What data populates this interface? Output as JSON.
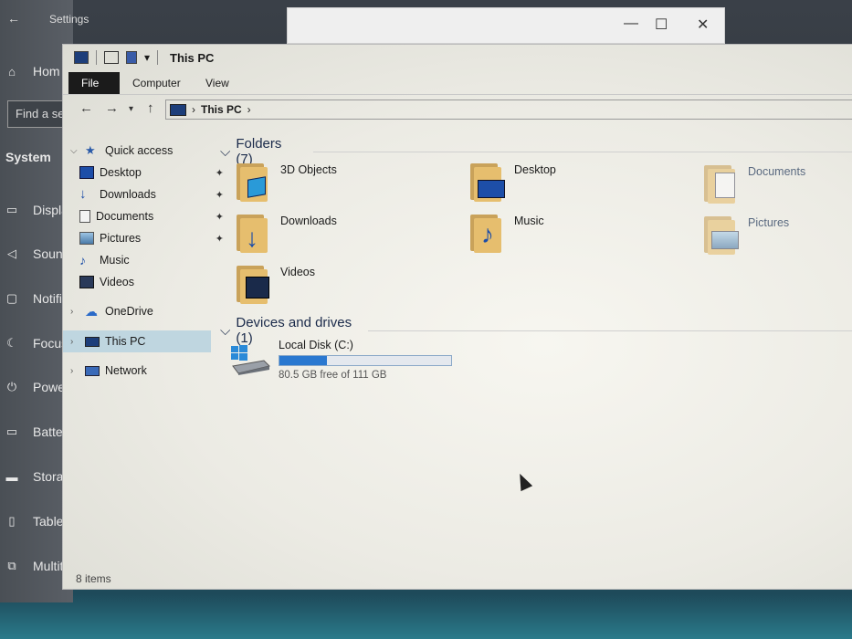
{
  "settings_window": {
    "title": "Settings",
    "search_placeholder": "Find a se",
    "home_label": "Hom",
    "section": "System",
    "items": [
      {
        "label": "Displa",
        "icon": "monitor-icon"
      },
      {
        "label": "Sounc",
        "icon": "speaker-icon"
      },
      {
        "label": "Notifi",
        "icon": "notification-icon"
      },
      {
        "label": "Focus",
        "icon": "moon-icon"
      },
      {
        "label": "Powei",
        "icon": "power-icon"
      },
      {
        "label": "Batter",
        "icon": "battery-icon"
      },
      {
        "label": "Storac",
        "icon": "storage-icon"
      },
      {
        "label": "Tablet",
        "icon": "tablet-icon"
      },
      {
        "label": "Multit",
        "icon": "multitask-icon"
      }
    ]
  },
  "explorer": {
    "title": "This PC",
    "ribbon_tabs": [
      {
        "label": "File"
      },
      {
        "label": "Computer"
      },
      {
        "label": "View"
      }
    ],
    "address": {
      "path": "This PC"
    },
    "sidebar": [
      {
        "label": "Quick access",
        "icon": "star-icon",
        "pinned": false
      },
      {
        "label": "Desktop",
        "icon": "desktop-icon",
        "pinned": true
      },
      {
        "label": "Downloads",
        "icon": "download-icon",
        "pinned": true
      },
      {
        "label": "Documents",
        "icon": "document-icon",
        "pinned": true
      },
      {
        "label": "Pictures",
        "icon": "pictures-icon",
        "pinned": true
      },
      {
        "label": "Music",
        "icon": "music-icon",
        "pinned": false
      },
      {
        "label": "Videos",
        "icon": "videos-icon",
        "pinned": false
      },
      {
        "label": "OneDrive",
        "icon": "cloud-icon",
        "pinned": false
      },
      {
        "label": "This PC",
        "icon": "computer-icon",
        "pinned": false,
        "selected": true
      },
      {
        "label": "Network",
        "icon": "network-icon",
        "pinned": false
      }
    ],
    "folders_header": "Folders (7)",
    "folders": [
      {
        "name": "3D Objects",
        "icon": "3d-objects-icon"
      },
      {
        "name": "Desktop",
        "icon": "desktop-folder-icon"
      },
      {
        "name": "Documents",
        "icon": "documents-folder-icon"
      },
      {
        "name": "Downloads",
        "icon": "downloads-folder-icon"
      },
      {
        "name": "Music",
        "icon": "music-folder-icon"
      },
      {
        "name": "Pictures",
        "icon": "pictures-folder-icon"
      },
      {
        "name": "Videos",
        "icon": "videos-folder-icon"
      }
    ],
    "drives_header": "Devices and drives (1)",
    "drives": [
      {
        "name": "Local Disk (C:)",
        "free_text": "80.5 GB free of 111 GB",
        "used_fraction": 0.275,
        "icon": "windows-drive-icon"
      }
    ],
    "status": "8 items"
  },
  "colors": {
    "accent": "#2a78d0",
    "selection": "#bfd6e0",
    "folder": "#e6be6e"
  }
}
